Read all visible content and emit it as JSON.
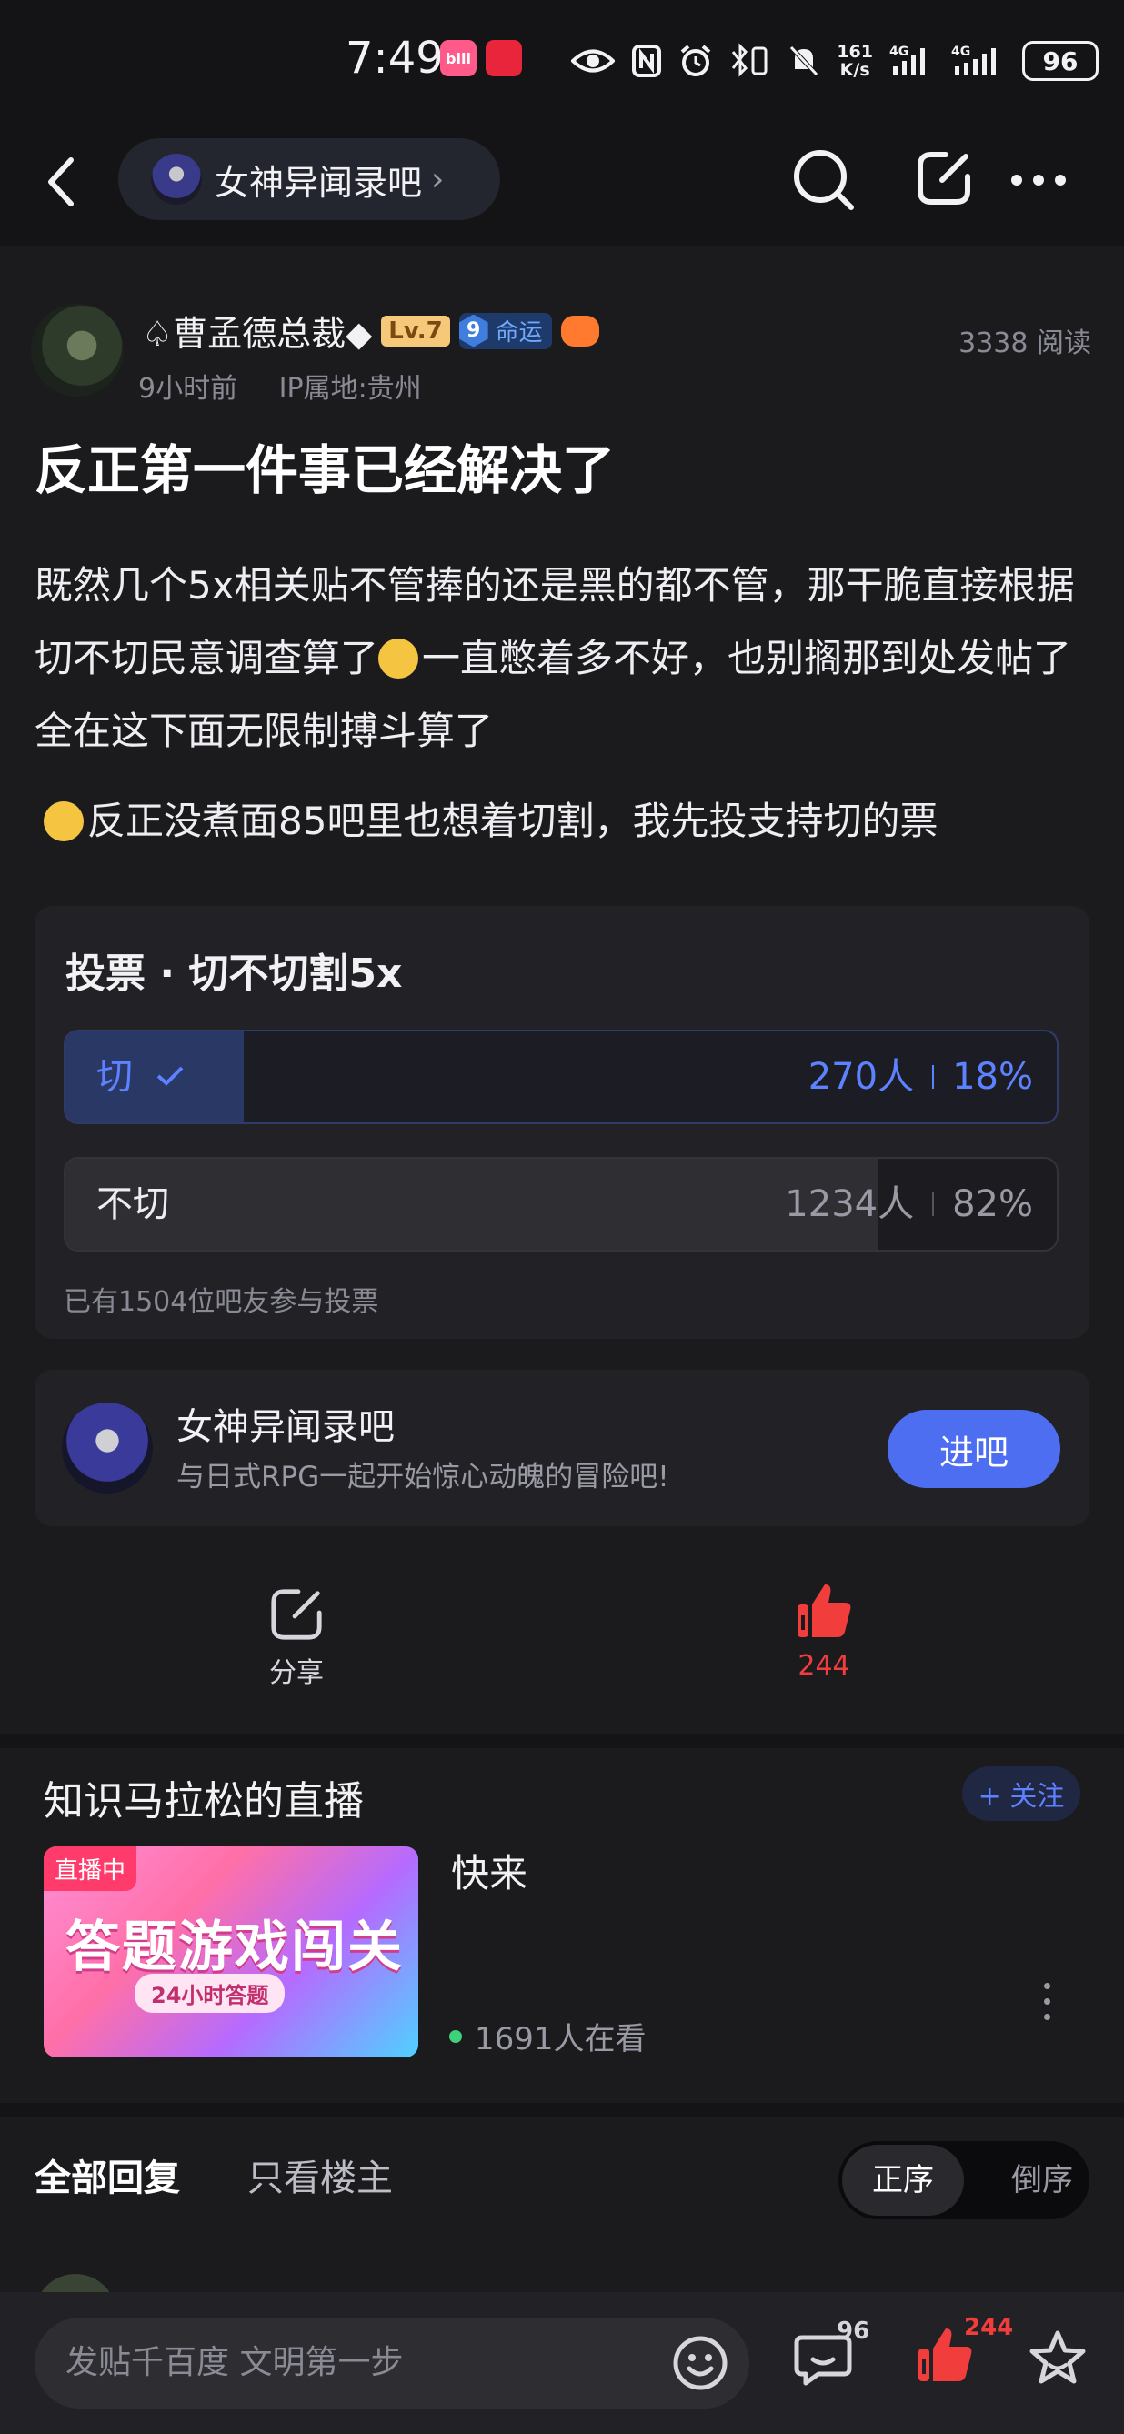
{
  "status_bar": {
    "time": "7:49",
    "net_speed_top": "161",
    "net_speed_unit": "K/s",
    "battery": "96",
    "app1": "bili",
    "app2": "icon"
  },
  "header": {
    "forum_name": "女神异闻录吧",
    "chevron": "›"
  },
  "post": {
    "author": "♤曹孟德总裁◆",
    "level": "Lv.7",
    "badge_num": "9",
    "badge_text": "命运",
    "time": "9小时前",
    "ip": "IP属地:贵州",
    "reads": "3338 阅读",
    "title": "反正第一件事已经解决了",
    "body1": "既然几个5x相关贴不管捧的还是黑的都不管，那干脆直接根据切不切民意调查算了",
    "body1b": "一直憋着多不好，也别搁那到处发帖了全在这下面无限制搏斗算了",
    "body2": "反正没煮面85吧里也想着切割，我先投支持切的票"
  },
  "vote": {
    "title": "投票 · 切不切割5x",
    "options": [
      {
        "label": "切",
        "count": "270人",
        "percent": "18%",
        "fraction": 0.18,
        "selected": true
      },
      {
        "label": "不切",
        "count": "1234人",
        "percent": "82%",
        "fraction": 0.82,
        "selected": false
      }
    ],
    "footer": "已有1504位吧友参与投票"
  },
  "forum_card": {
    "name": "女神异闻录吧",
    "desc": "与日式RPG一起开始惊心动魄的冒险吧!",
    "button": "进吧"
  },
  "actions": {
    "share": "分享",
    "likes": "244"
  },
  "live": {
    "section_title": "知识马拉松的直播",
    "follow": "+ 关注",
    "badge": "直播中",
    "thumb_title": "答题游戏闯关",
    "thumb_sub": "24小时答题",
    "name": "快来",
    "viewers": "1691人在看"
  },
  "replies": {
    "tab_all": "全部回复",
    "tab_op": "只看楼主",
    "sort_asc": "正序",
    "sort_desc": "倒序"
  },
  "bottom": {
    "placeholder": "发贴千百度 文明第一步",
    "comment_count": "96",
    "like_count": "244"
  },
  "colors": {
    "accent": "#4e6ef2",
    "like_red": "#f23d3d",
    "bg": "#141417",
    "card": "#222226"
  }
}
